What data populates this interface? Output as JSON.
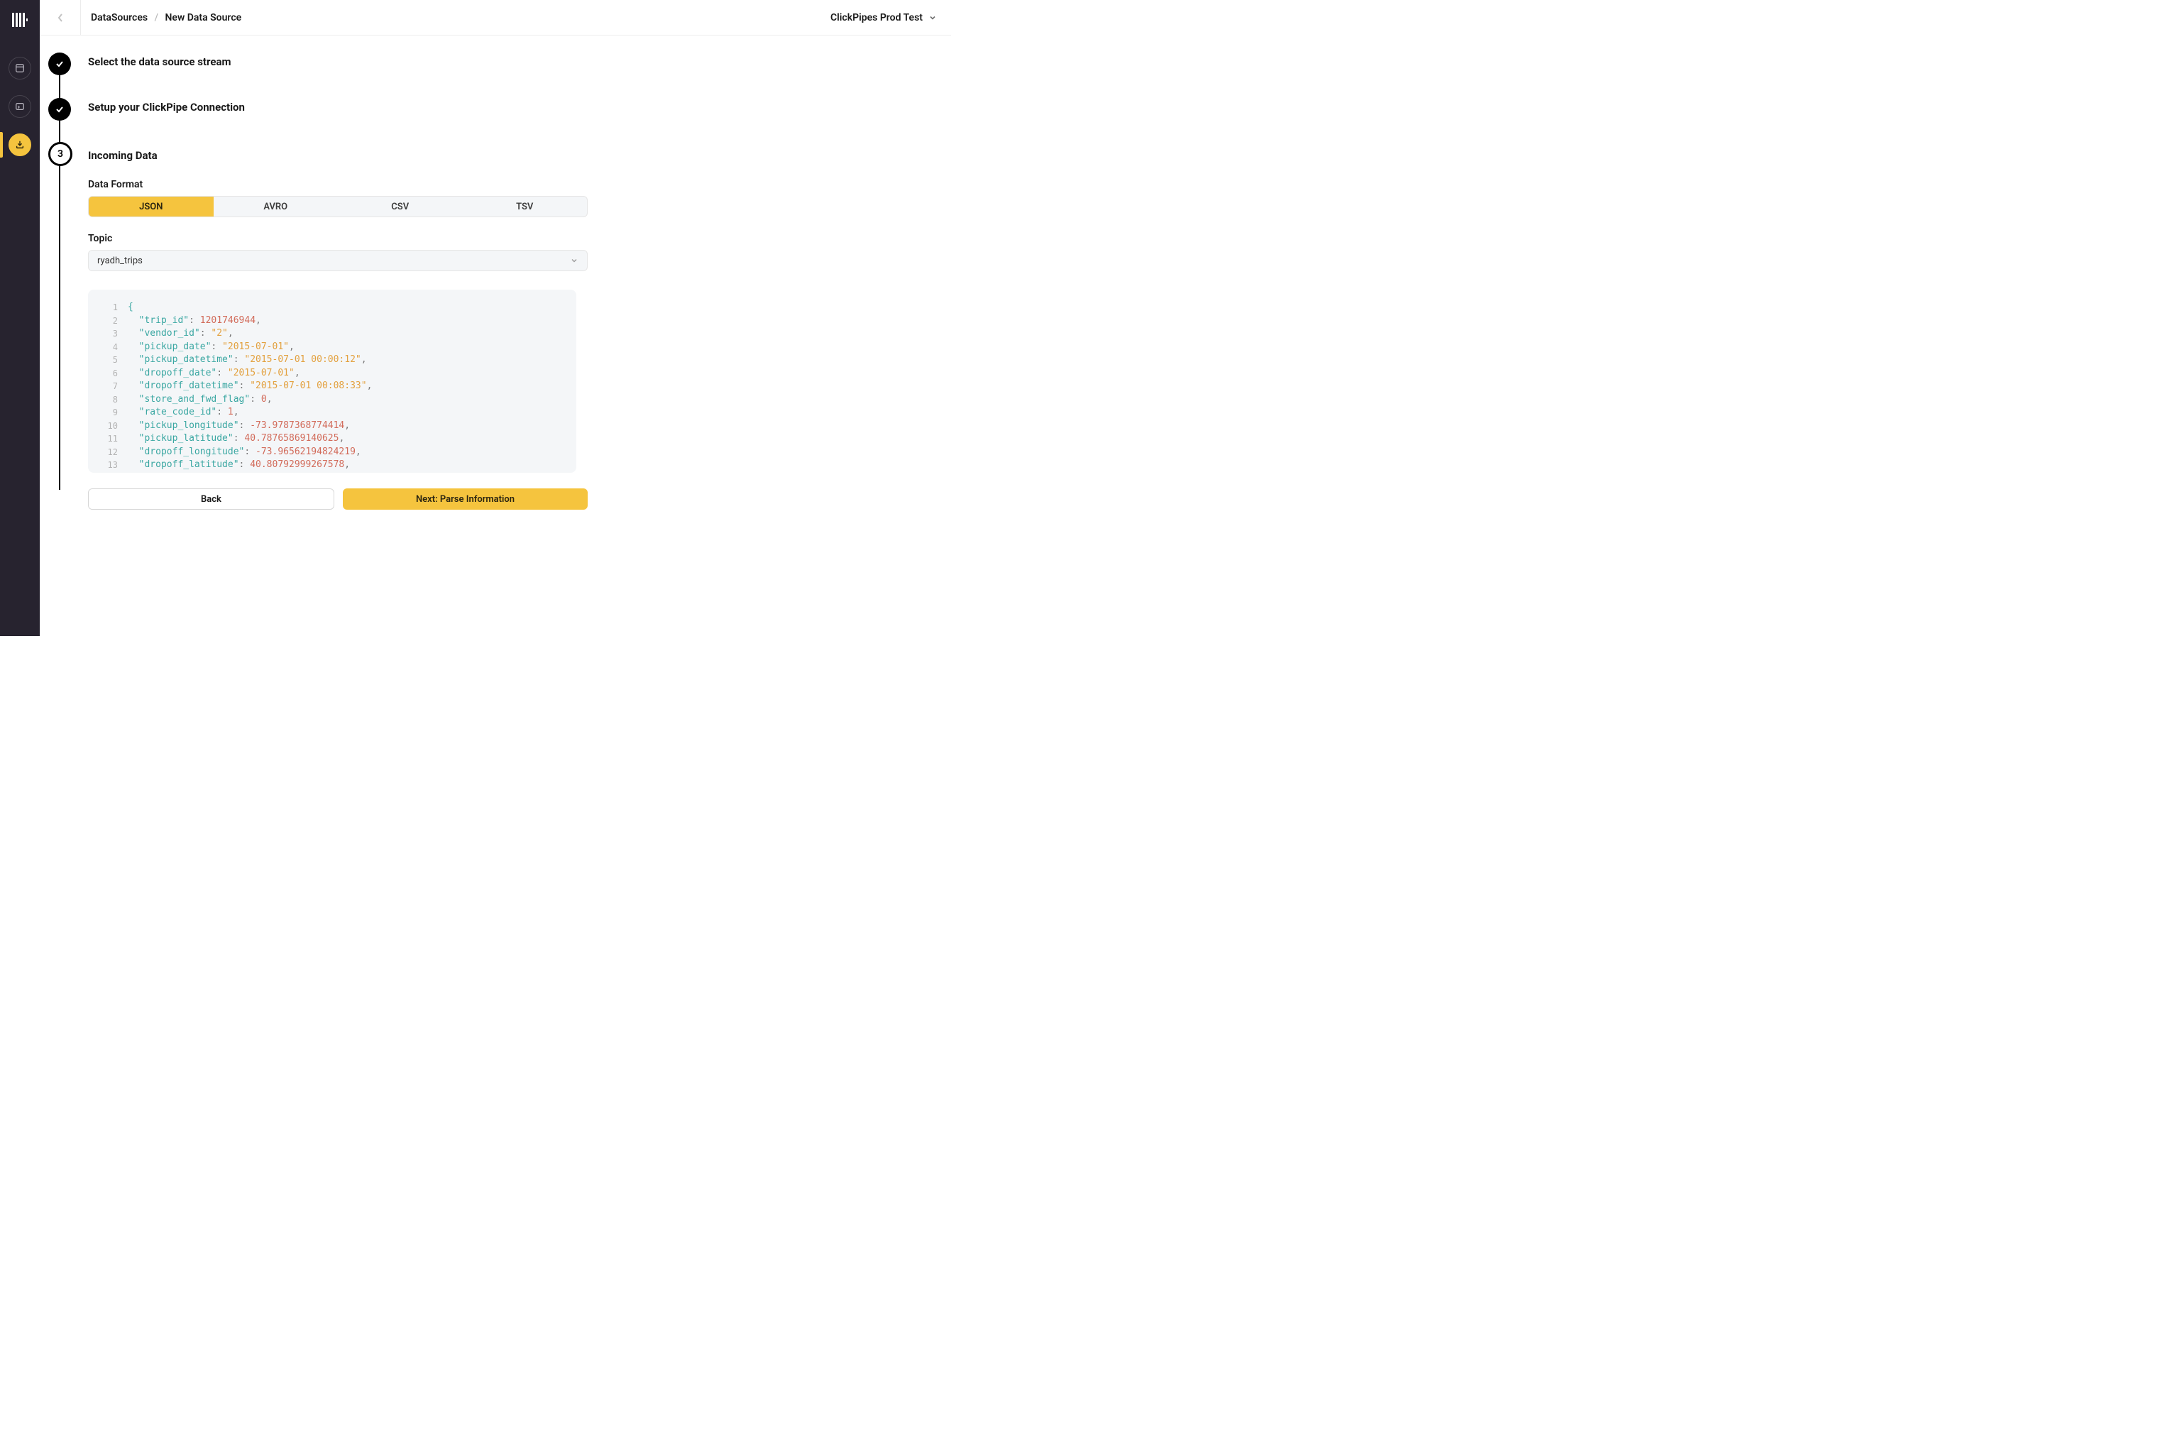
{
  "breadcrumb": {
    "root": "DataSources",
    "current": "New Data Source"
  },
  "workspace": {
    "label": "ClickPipes Prod Test"
  },
  "steps": {
    "one": {
      "title": "Select the data source stream"
    },
    "two": {
      "title": "Setup your ClickPipe Connection"
    },
    "three": {
      "title": "Incoming Data",
      "badge": "3"
    }
  },
  "format": {
    "label": "Data Format",
    "options": [
      "JSON",
      "AVRO",
      "CSV",
      "TSV"
    ],
    "active": 0
  },
  "topic": {
    "label": "Topic",
    "value": "ryadh_trips"
  },
  "code": [
    [
      {
        "t": "br",
        "v": "{"
      }
    ],
    [
      {
        "t": "sp",
        "v": "  "
      },
      {
        "t": "key",
        "v": "\"trip_id\""
      },
      {
        "t": "p",
        "v": ": "
      },
      {
        "t": "num",
        "v": "1201746944"
      },
      {
        "t": "p",
        "v": ","
      }
    ],
    [
      {
        "t": "sp",
        "v": "  "
      },
      {
        "t": "key",
        "v": "\"vendor_id\""
      },
      {
        "t": "p",
        "v": ": "
      },
      {
        "t": "str",
        "v": "\"2\""
      },
      {
        "t": "p",
        "v": ","
      }
    ],
    [
      {
        "t": "sp",
        "v": "  "
      },
      {
        "t": "key",
        "v": "\"pickup_date\""
      },
      {
        "t": "p",
        "v": ": "
      },
      {
        "t": "str",
        "v": "\"2015-07-01\""
      },
      {
        "t": "p",
        "v": ","
      }
    ],
    [
      {
        "t": "sp",
        "v": "  "
      },
      {
        "t": "key",
        "v": "\"pickup_datetime\""
      },
      {
        "t": "p",
        "v": ": "
      },
      {
        "t": "str",
        "v": "\"2015-07-01 00:00:12\""
      },
      {
        "t": "p",
        "v": ","
      }
    ],
    [
      {
        "t": "sp",
        "v": "  "
      },
      {
        "t": "key",
        "v": "\"dropoff_date\""
      },
      {
        "t": "p",
        "v": ": "
      },
      {
        "t": "str",
        "v": "\"2015-07-01\""
      },
      {
        "t": "p",
        "v": ","
      }
    ],
    [
      {
        "t": "sp",
        "v": "  "
      },
      {
        "t": "key",
        "v": "\"dropoff_datetime\""
      },
      {
        "t": "p",
        "v": ": "
      },
      {
        "t": "str",
        "v": "\"2015-07-01 00:08:33\""
      },
      {
        "t": "p",
        "v": ","
      }
    ],
    [
      {
        "t": "sp",
        "v": "  "
      },
      {
        "t": "key",
        "v": "\"store_and_fwd_flag\""
      },
      {
        "t": "p",
        "v": ": "
      },
      {
        "t": "num",
        "v": "0"
      },
      {
        "t": "p",
        "v": ","
      }
    ],
    [
      {
        "t": "sp",
        "v": "  "
      },
      {
        "t": "key",
        "v": "\"rate_code_id\""
      },
      {
        "t": "p",
        "v": ": "
      },
      {
        "t": "num",
        "v": "1"
      },
      {
        "t": "p",
        "v": ","
      }
    ],
    [
      {
        "t": "sp",
        "v": "  "
      },
      {
        "t": "key",
        "v": "\"pickup_longitude\""
      },
      {
        "t": "p",
        "v": ": "
      },
      {
        "t": "num",
        "v": "-73.9787368774414"
      },
      {
        "t": "p",
        "v": ","
      }
    ],
    [
      {
        "t": "sp",
        "v": "  "
      },
      {
        "t": "key",
        "v": "\"pickup_latitude\""
      },
      {
        "t": "p",
        "v": ": "
      },
      {
        "t": "num",
        "v": "40.78765869140625"
      },
      {
        "t": "p",
        "v": ","
      }
    ],
    [
      {
        "t": "sp",
        "v": "  "
      },
      {
        "t": "key",
        "v": "\"dropoff_longitude\""
      },
      {
        "t": "p",
        "v": ": "
      },
      {
        "t": "num",
        "v": "-73.96562194824219"
      },
      {
        "t": "p",
        "v": ","
      }
    ],
    [
      {
        "t": "sp",
        "v": "  "
      },
      {
        "t": "key",
        "v": "\"dropoff_latitude\""
      },
      {
        "t": "p",
        "v": ": "
      },
      {
        "t": "num",
        "v": "40.80792999267578"
      },
      {
        "t": "p",
        "v": ","
      }
    ]
  ],
  "buttons": {
    "back": "Back",
    "next": "Next: Parse Information"
  }
}
